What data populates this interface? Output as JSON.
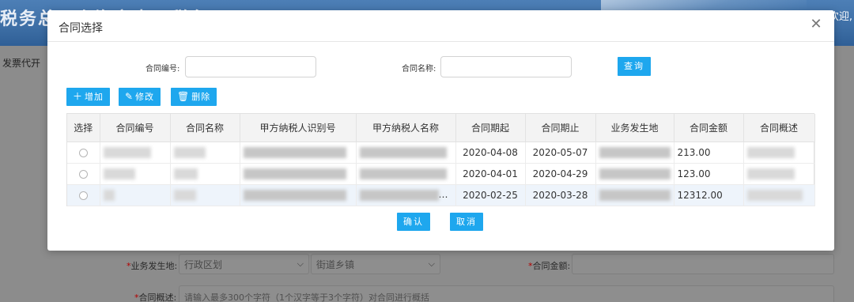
{
  "background": {
    "header_title": "税务总局上海市电子税务局",
    "welcome": "欢迎,",
    "menu_item": "发票代开",
    "business_place_label": "业务发生地:",
    "district_placeholder": "行政区划",
    "street_placeholder": "街道乡镇",
    "contract_amount_label": "合同金额:",
    "contract_summary_label": "合同概述:",
    "summary_placeholder": "请输入最多300个字符（1个汉字等于3个字符）对合同进行概括"
  },
  "modal": {
    "title": "合同选择",
    "close_icon": "close-icon",
    "search": {
      "contract_no_label": "合同编号:",
      "contract_no_value": "",
      "contract_name_label": "合同名称:",
      "contract_name_value": "",
      "query_label": "查询"
    },
    "toolbar": {
      "add_label": "增加",
      "edit_label": "修改",
      "delete_label": "删除"
    },
    "table": {
      "columns": [
        "选择",
        "合同编号",
        "合同名称",
        "甲方纳税人识别号",
        "甲方纳税人名称",
        "合同期起",
        "合同期止",
        "业务发生地",
        "合同金额",
        "合同概述"
      ],
      "rows": [
        {
          "start": "2020-04-08",
          "end": "2020-05-07",
          "amount": "213.00",
          "party_name": ""
        },
        {
          "start": "2020-04-01",
          "end": "2020-04-29",
          "amount": "123.00",
          "party_name": ""
        },
        {
          "start": "2020-02-25",
          "end": "2020-03-28",
          "amount": "12312.00",
          "party_name": "…"
        }
      ]
    },
    "footer": {
      "confirm_label": "确认",
      "cancel_label": "取消"
    }
  },
  "colors": {
    "accent": "#1ea7ee",
    "overlay": "#8c8c8c"
  }
}
